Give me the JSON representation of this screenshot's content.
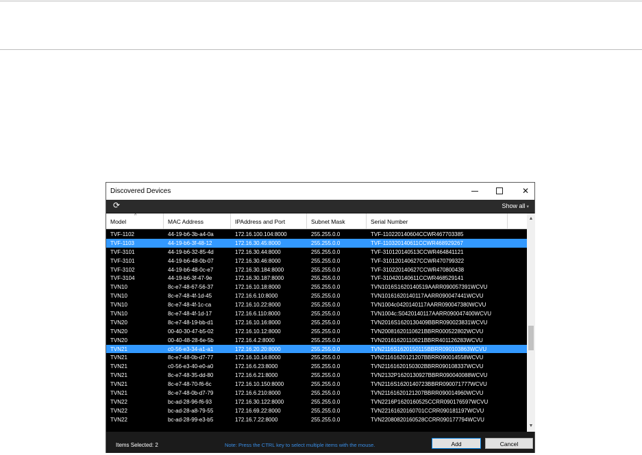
{
  "window": {
    "title": "Discovered Devices"
  },
  "toolbar": {
    "show_all": "Show all"
  },
  "columns": [
    "Model",
    "MAC Address",
    "IPAddress and Port",
    "Subnet Mask",
    "Serial Number"
  ],
  "rows": [
    [
      "TVF-1102",
      "44-19-b6-3b-a4-0a",
      "172.16.100.104:8000",
      "255.255.0.0",
      "TVF-110220140604CCWR467703385"
    ],
    [
      "TVF-1103",
      "44-19-b6-3f-48-12",
      "172.16.30.45:8000",
      "255.255.0.0",
      "TVF-110320140611CCWR468929267"
    ],
    [
      "TVF-3101",
      "44-19-b6-32-85-4d",
      "172.16.30.44:8000",
      "255.255.0.0",
      "TVF-310120140513CCWR464841121"
    ],
    [
      "TVF-3101",
      "44-19-b6-48-0b-07",
      "172.16.30.46:8000",
      "255.255.0.0",
      "TVF-310120140627CCWR470799322"
    ],
    [
      "TVF-3102",
      "44-19-b6-48-0c-e7",
      "172.16.30.184:8000",
      "255.255.0.0",
      "TVF-310220140627CCWR470800438"
    ],
    [
      "TVF-3104",
      "44-19-b6-3f-47-9e",
      "172.16.30.187:8000",
      "255.255.0.0",
      "TVF-310420140611CCWR468529141"
    ],
    [
      "TVN10",
      "8c-e7-48-67-56-37",
      "172.16.10.18:8000",
      "255.255.0.0",
      "TVN1016S1620140519AARR090057391WCVU"
    ],
    [
      "TVN10",
      "8c-e7-48-4f-1d-45",
      "172.16.6.10:8000",
      "255.255.0.0",
      "TVN10161620140117AARR090047441WCVU"
    ],
    [
      "TVN10",
      "8c-e7-48-4f-1c-ca",
      "172.16.10.22:8000",
      "255.255.0.0",
      "TVN1004c0420140117AARR090047380WCVU"
    ],
    [
      "TVN10",
      "8c-e7-48-4f-1d-17",
      "172.16.6.110:8000",
      "255.255.0.0",
      "TVN1004c:S0420140117AARR090047400WCVU"
    ],
    [
      "TVN20",
      "8c-e7-48-19-bb-d1",
      "172.16.10.16:8000",
      "255.255.0.0",
      "TVN2016S1620130409BBRR090023831WCVU"
    ],
    [
      "TVN20",
      "00-40-30-47-b5-02",
      "172.16.10.12:8000",
      "255.255.0.0",
      "TVN20081620110621BBRR000522802WCVU"
    ],
    [
      "TVN20",
      "00-40-48-28-6e-5b",
      "172.16.4.2:8000",
      "255.255.0.0",
      "TVN20161620110621BBRR401126283WCVU"
    ],
    [
      "TVN21",
      "c0-56-e3-34-a1-a1",
      "172.16.20.20:8000",
      "255.255.0.0",
      "TVN2116S1620150115BBRR090103863WCVU"
    ],
    [
      "TVN21",
      "8c-e7-48-0b-d7-77",
      "172.16.10.14:8000",
      "255.255.0.0",
      "TVN21161620121207BBRR090014558WCVU"
    ],
    [
      "TVN21",
      "c0-56-e3-40-e0-a0",
      "172.16.6.23:8000",
      "255.255.0.0",
      "TVN21161620150302BBRR090108337WCVU"
    ],
    [
      "TVN21",
      "8c-e7-48-35-dd-80",
      "172.16.6.21:8000",
      "255.255.0.0",
      "TVN2132P1620130927BBRR090040088WCVU"
    ],
    [
      "TVN21",
      "8c-e7-48-70-f6-6c",
      "172.16.10.150:8000",
      "255.255.0.0",
      "TVN2116S1620140723BBRR090071777WCVU"
    ],
    [
      "TVN21",
      "8c-e7-48-0b-d7-79",
      "172.16.6.210:8000",
      "255.255.0.0",
      "TVN21161620121207BBRR090014960WCVU"
    ],
    [
      "TVN22",
      "bc-ad-28-96-f6-93",
      "172.16.30.122:8000",
      "255.255.0.0",
      "TVN2216P1620160525CCRR090176597WCVU"
    ],
    [
      "TVN22",
      "bc-ad-28-a8-79-55",
      "172.16.69.22:8000",
      "255.255.0.0",
      "TVN22161620160701CCRR090181197WCVU"
    ],
    [
      "TVN22",
      "bc-ad-28-99-e3-b5",
      "172.16.7.22:8000",
      "255.255.0.0",
      "TVN22080820160528CCRR090177794WCVU"
    ]
  ],
  "selected_rows": [
    1,
    13
  ],
  "footer": {
    "items_selected": "Items Selected: 2",
    "note": "Note: Press the CTRL key to select multiple items with the mouse.",
    "add_label": "Add",
    "cancel_label": "Cancel"
  }
}
